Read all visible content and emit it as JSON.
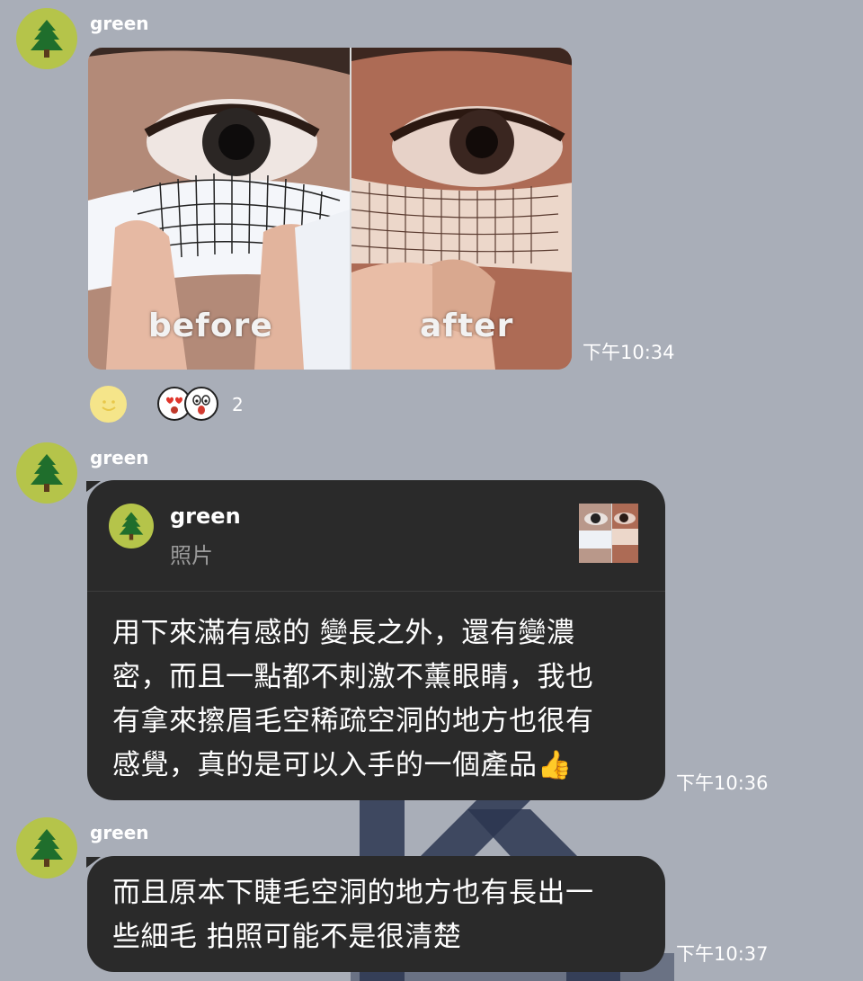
{
  "messages": [
    {
      "sender": "green",
      "avatar_icon": "tree-icon",
      "type": "photo",
      "photo": {
        "before_label": "before",
        "after_label": "after"
      },
      "time": "下午10:34",
      "reactions": {
        "add_icon": "smiley-icon",
        "icons": [
          "heart-eyes-icon",
          "shocked-face-icon"
        ],
        "count": "2"
      }
    },
    {
      "sender": "green",
      "avatar_icon": "tree-icon",
      "type": "reply",
      "reply_to": {
        "sender": "green",
        "type_label": "照片"
      },
      "text_lines": [
        "用下來滿有感的  變長之外，還有變濃",
        "密，而且一點都不刺激不薰眼睛，我也",
        "有拿來擦眉毛空稀疏空洞的地方也很有",
        "感覺，真的是可以入手的一個產品👍"
      ],
      "time": "下午10:36"
    },
    {
      "sender": "green",
      "avatar_icon": "tree-icon",
      "type": "text",
      "text_lines": [
        "而且原本下睫毛空洞的地方也有長出一",
        "些細毛  拍照可能不是很清楚"
      ],
      "time": "下午10:37"
    }
  ],
  "colors": {
    "background": "#a9aeb8",
    "bubble": "#2a2a2a",
    "avatar": "#b5c44a",
    "tree": "#1f6e2c"
  }
}
